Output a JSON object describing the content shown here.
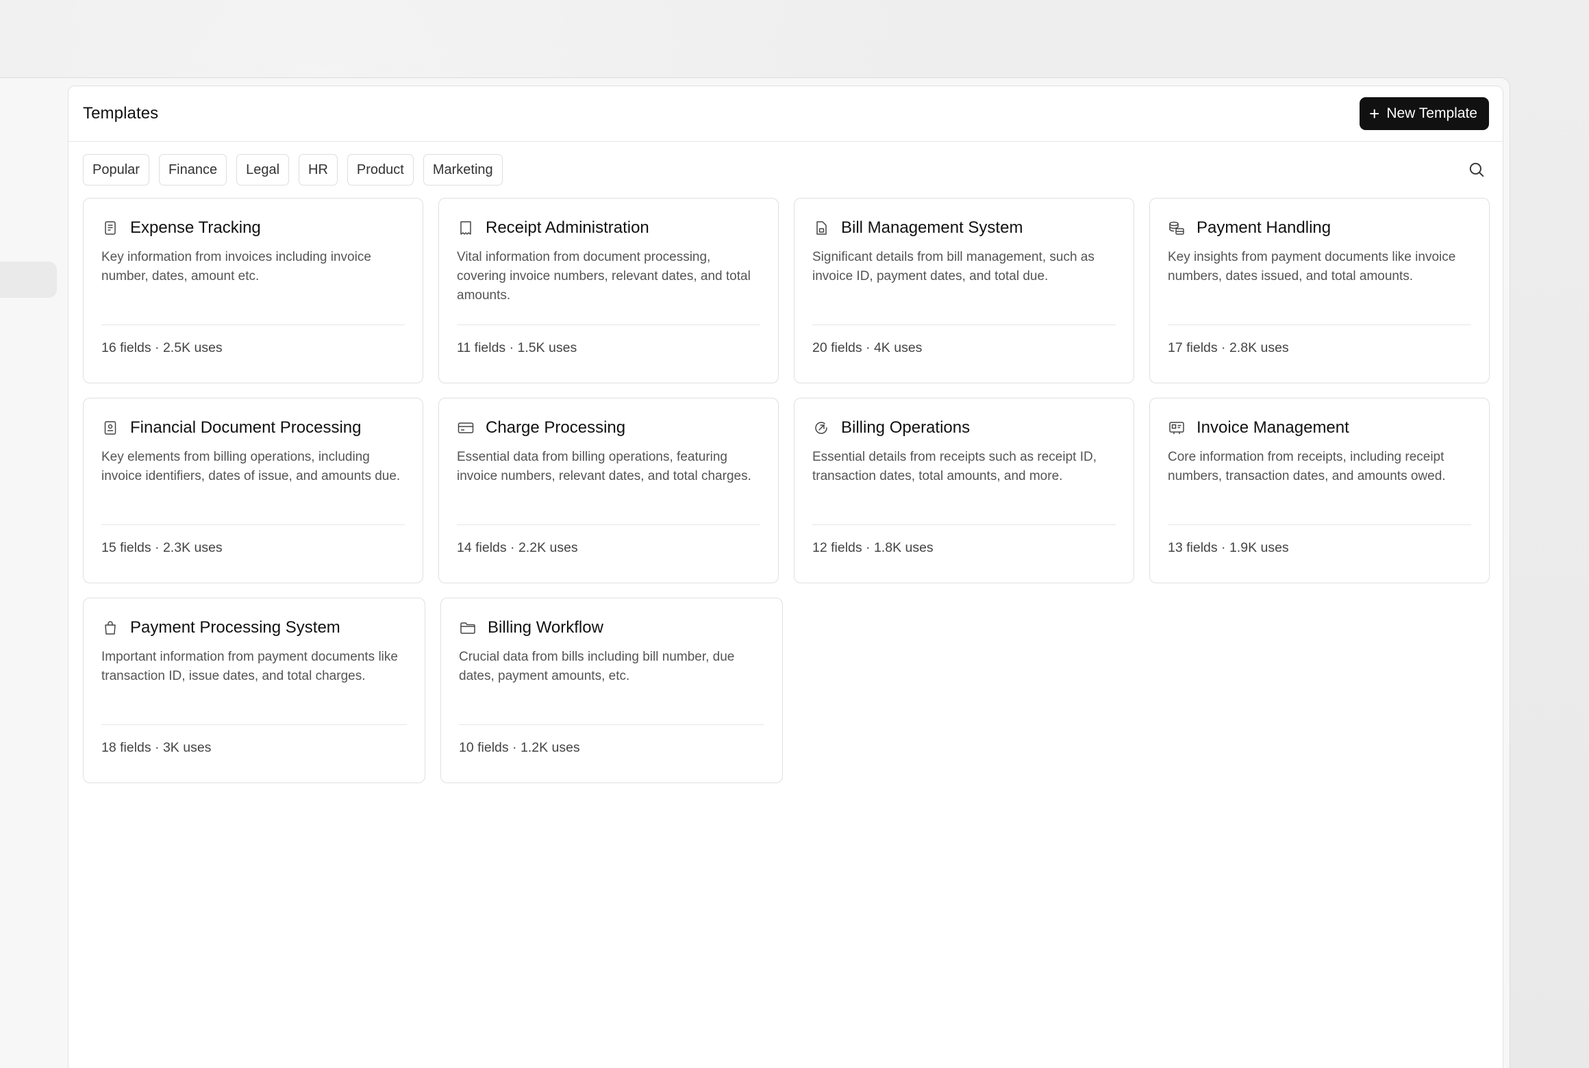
{
  "header": {
    "title": "Templates",
    "new_button_label": "New Template"
  },
  "filters": [
    "Popular",
    "Finance",
    "Legal",
    "HR",
    "Product",
    "Marketing"
  ],
  "cards": [
    {
      "title": "Expense Tracking",
      "icon": "document-icon",
      "description": "Key information from invoices including invoice number, dates, amount etc.",
      "meta": "16 fields · 2.5K uses"
    },
    {
      "title": "Receipt Administration",
      "icon": "receipt-icon",
      "description": "Vital information from document processing, covering invoice numbers, relevant dates, and total amounts.",
      "meta": "11 fields · 1.5K uses"
    },
    {
      "title": "Bill Management System",
      "icon": "file-icon",
      "description": "Significant details from bill management, such as invoice ID, payment dates, and total due.",
      "meta": "20 fields · 4K uses"
    },
    {
      "title": "Payment Handling",
      "icon": "coins-icon",
      "description": "Key insights from payment documents like invoice numbers, dates issued, and total amounts.",
      "meta": "17 fields · 2.8K uses"
    },
    {
      "title": "Financial Document Processing",
      "icon": "certificate-icon",
      "description": "Key elements from billing operations, including invoice identifiers, dates of issue, and amounts due.",
      "meta": "15 fields · 2.3K uses"
    },
    {
      "title": "Charge Processing",
      "icon": "credit-card-icon",
      "description": "Essential data from billing operations, featuring invoice numbers, relevant dates, and total charges.",
      "meta": "14 fields · 2.2K uses"
    },
    {
      "title": "Billing Operations",
      "icon": "arrow-circle-icon",
      "description": "Essential details from receipts such as receipt ID, transaction dates, total amounts, and more.",
      "meta": "12 fields · 1.8K uses"
    },
    {
      "title": "Invoice Management",
      "icon": "id-card-icon",
      "description": "Core information from receipts, including receipt numbers, transaction dates, and amounts owed.",
      "meta": "13 fields · 1.9K uses"
    },
    {
      "title": "Payment Processing System",
      "icon": "shopping-bag-icon",
      "description": "Important information from payment documents like transaction ID, issue dates, and total charges.",
      "meta": "18 fields · 3K uses"
    },
    {
      "title": "Billing Workflow",
      "icon": "folder-icon",
      "description": "Crucial data from bills including bill number, due dates, payment amounts, etc.",
      "meta": "10 fields · 1.2K uses"
    }
  ]
}
